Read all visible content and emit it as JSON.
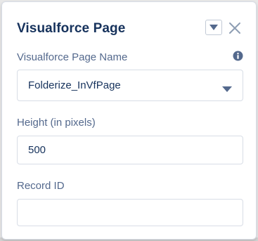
{
  "panel": {
    "title": "Visualforce Page",
    "menu_icon": "chevron-down-icon",
    "close_icon": "close-icon"
  },
  "fields": {
    "page_name": {
      "label": "Visualforce Page Name",
      "value": "Folderize_InVfPage",
      "info_icon": "info-icon"
    },
    "height": {
      "label": "Height (in pixels)",
      "value": "500"
    },
    "record_id": {
      "label": "Record ID",
      "value": ""
    }
  },
  "colors": {
    "title": "#16325c",
    "label": "#54698d",
    "border": "#d8dde6",
    "icon": "#54698d"
  }
}
